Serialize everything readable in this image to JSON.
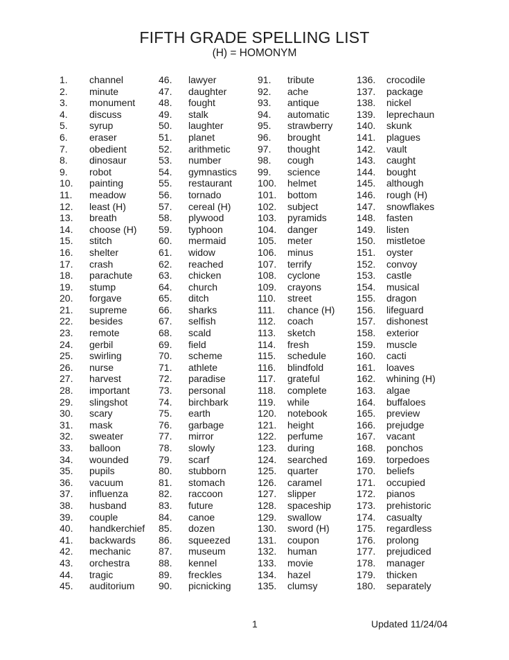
{
  "header": {
    "title": "FIFTH GRADE SPELLING LIST",
    "subtitle": "(H) = HOMONYM"
  },
  "columns": [
    [
      {
        "n": "1.",
        "w": "channel"
      },
      {
        "n": "2.",
        "w": "minute"
      },
      {
        "n": "3.",
        "w": "monument"
      },
      {
        "n": "4.",
        "w": "discuss"
      },
      {
        "n": "5.",
        "w": "syrup"
      },
      {
        "n": "6.",
        "w": "eraser"
      },
      {
        "n": "7.",
        "w": "obedient"
      },
      {
        "n": "8.",
        "w": "dinosaur"
      },
      {
        "n": "9.",
        "w": "robot"
      },
      {
        "n": "10.",
        "w": "painting"
      },
      {
        "n": "11.",
        "w": "meadow"
      },
      {
        "n": "12.",
        "w": "least (H)"
      },
      {
        "n": "13.",
        "w": "breath"
      },
      {
        "n": "14.",
        "w": "choose (H)"
      },
      {
        "n": "15.",
        "w": "stitch"
      },
      {
        "n": "16.",
        "w": "shelter"
      },
      {
        "n": "17.",
        "w": "crash"
      },
      {
        "n": "18.",
        "w": "parachute"
      },
      {
        "n": "19.",
        "w": "stump"
      },
      {
        "n": "20.",
        "w": "forgave"
      },
      {
        "n": "21.",
        "w": "supreme"
      },
      {
        "n": "22.",
        "w": "besides"
      },
      {
        "n": "23.",
        "w": "remote"
      },
      {
        "n": "24.",
        "w": "gerbil"
      },
      {
        "n": "25.",
        "w": "swirling"
      },
      {
        "n": "26.",
        "w": "nurse"
      },
      {
        "n": "27.",
        "w": "harvest"
      },
      {
        "n": "28.",
        "w": "important"
      },
      {
        "n": "29.",
        "w": "slingshot"
      },
      {
        "n": "30.",
        "w": "scary"
      },
      {
        "n": "31.",
        "w": "mask"
      },
      {
        "n": "32.",
        "w": "sweater"
      },
      {
        "n": "33.",
        "w": "balloon"
      },
      {
        "n": "34.",
        "w": "wounded"
      },
      {
        "n": "35.",
        "w": "pupils"
      },
      {
        "n": "36.",
        "w": "vacuum"
      },
      {
        "n": "37.",
        "w": "influenza"
      },
      {
        "n": "38.",
        "w": "husband"
      },
      {
        "n": "39.",
        "w": "couple"
      },
      {
        "n": "40.",
        "w": "handkerchief"
      },
      {
        "n": "41.",
        "w": "backwards"
      },
      {
        "n": "42.",
        "w": "mechanic"
      },
      {
        "n": "43.",
        "w": "orchestra"
      },
      {
        "n": "44.",
        "w": "tragic"
      },
      {
        "n": "45.",
        "w": "auditorium"
      }
    ],
    [
      {
        "n": "46.",
        "w": "lawyer"
      },
      {
        "n": "47.",
        "w": "daughter"
      },
      {
        "n": "48.",
        "w": "fought"
      },
      {
        "n": "49.",
        "w": "stalk"
      },
      {
        "n": "50.",
        "w": "laughter"
      },
      {
        "n": "51.",
        "w": "planet"
      },
      {
        "n": "52.",
        "w": "arithmetic"
      },
      {
        "n": "53.",
        "w": "number"
      },
      {
        "n": "54.",
        "w": "gymnastics"
      },
      {
        "n": "55.",
        "w": "restaurant"
      },
      {
        "n": "56.",
        "w": "tornado"
      },
      {
        "n": "57.",
        "w": "cereal (H)"
      },
      {
        "n": "58.",
        "w": "plywood"
      },
      {
        "n": "59.",
        "w": "typhoon"
      },
      {
        "n": "60.",
        "w": "mermaid"
      },
      {
        "n": "61.",
        "w": "widow"
      },
      {
        "n": "62.",
        "w": "reached"
      },
      {
        "n": "63.",
        "w": "chicken"
      },
      {
        "n": "64.",
        "w": "church"
      },
      {
        "n": "65.",
        "w": "ditch"
      },
      {
        "n": "66.",
        "w": "sharks"
      },
      {
        "n": "67.",
        "w": "selfish"
      },
      {
        "n": "68.",
        "w": "scald"
      },
      {
        "n": "69.",
        "w": "field"
      },
      {
        "n": "70.",
        "w": "scheme"
      },
      {
        "n": "71.",
        "w": "athlete"
      },
      {
        "n": "72.",
        "w": "paradise"
      },
      {
        "n": "73.",
        "w": "personal"
      },
      {
        "n": "74.",
        "w": "birchbark"
      },
      {
        "n": "75.",
        "w": "earth"
      },
      {
        "n": "76.",
        "w": "garbage"
      },
      {
        "n": "77.",
        "w": "mirror"
      },
      {
        "n": "78.",
        "w": "slowly"
      },
      {
        "n": "79.",
        "w": "scarf"
      },
      {
        "n": "80.",
        "w": "stubborn"
      },
      {
        "n": "81.",
        "w": "stomach"
      },
      {
        "n": "82.",
        "w": "raccoon"
      },
      {
        "n": "83.",
        "w": "future"
      },
      {
        "n": "84.",
        "w": "canoe"
      },
      {
        "n": "85.",
        "w": "dozen"
      },
      {
        "n": "86.",
        "w": "squeezed"
      },
      {
        "n": "87.",
        "w": "museum"
      },
      {
        "n": "88.",
        "w": "kennel"
      },
      {
        "n": "89.",
        "w": "freckles"
      },
      {
        "n": "90.",
        "w": "picnicking"
      }
    ],
    [
      {
        "n": "91.",
        "w": "tribute"
      },
      {
        "n": "92.",
        "w": "ache"
      },
      {
        "n": "93.",
        "w": "antique"
      },
      {
        "n": "94.",
        "w": "automatic"
      },
      {
        "n": "95.",
        "w": "strawberry"
      },
      {
        "n": "96.",
        "w": "brought"
      },
      {
        "n": "97.",
        "w": "thought"
      },
      {
        "n": "98.",
        "w": "cough"
      },
      {
        "n": "99.",
        "w": "science"
      },
      {
        "n": "100.",
        "w": "helmet"
      },
      {
        "n": "101.",
        "w": "bottom"
      },
      {
        "n": "102.",
        "w": "subject"
      },
      {
        "n": "103.",
        "w": "pyramids"
      },
      {
        "n": "104.",
        "w": "danger"
      },
      {
        "n": "105.",
        "w": "meter"
      },
      {
        "n": "106.",
        "w": "minus"
      },
      {
        "n": "107.",
        "w": "terrify"
      },
      {
        "n": "108.",
        "w": "cyclone"
      },
      {
        "n": "109.",
        "w": "crayons"
      },
      {
        "n": "110.",
        "w": "street"
      },
      {
        "n": "111.",
        "w": "chance (H)"
      },
      {
        "n": "112.",
        "w": "coach"
      },
      {
        "n": "113.",
        "w": "sketch"
      },
      {
        "n": "114.",
        "w": "fresh"
      },
      {
        "n": "115.",
        "w": "schedule"
      },
      {
        "n": "116.",
        "w": "blindfold"
      },
      {
        "n": "117.",
        "w": "grateful"
      },
      {
        "n": "118.",
        "w": "complete"
      },
      {
        "n": "119.",
        "w": "while"
      },
      {
        "n": "120.",
        "w": "notebook"
      },
      {
        "n": "121.",
        "w": "height"
      },
      {
        "n": "122.",
        "w": "perfume"
      },
      {
        "n": "123.",
        "w": "during"
      },
      {
        "n": "124.",
        "w": "searched"
      },
      {
        "n": "125.",
        "w": "quarter"
      },
      {
        "n": "126.",
        "w": "caramel"
      },
      {
        "n": "127.",
        "w": "slipper"
      },
      {
        "n": "128.",
        "w": "spaceship"
      },
      {
        "n": "129.",
        "w": "swallow"
      },
      {
        "n": "130.",
        "w": "sword (H)"
      },
      {
        "n": "131.",
        "w": "coupon"
      },
      {
        "n": "132.",
        "w": "human"
      },
      {
        "n": "133.",
        "w": "movie"
      },
      {
        "n": "134.",
        "w": "hazel"
      },
      {
        "n": "135.",
        "w": "clumsy"
      }
    ],
    [
      {
        "n": "136.",
        "w": "crocodile"
      },
      {
        "n": "137.",
        "w": "package"
      },
      {
        "n": "138.",
        "w": "nickel"
      },
      {
        "n": "139.",
        "w": "leprechaun"
      },
      {
        "n": "140.",
        "w": "skunk"
      },
      {
        "n": "141.",
        "w": "plagues"
      },
      {
        "n": "142.",
        "w": "vault"
      },
      {
        "n": "143.",
        "w": "caught"
      },
      {
        "n": "144.",
        "w": "bought"
      },
      {
        "n": "145.",
        "w": "although"
      },
      {
        "n": "146.",
        "w": "rough (H)"
      },
      {
        "n": "147.",
        "w": "snowflakes"
      },
      {
        "n": "148.",
        "w": "fasten"
      },
      {
        "n": "149.",
        "w": "listen"
      },
      {
        "n": "150.",
        "w": "mistletoe"
      },
      {
        "n": "151.",
        "w": "oyster"
      },
      {
        "n": "152.",
        "w": "convoy"
      },
      {
        "n": "153.",
        "w": "castle"
      },
      {
        "n": "154.",
        "w": "musical"
      },
      {
        "n": "155.",
        "w": "dragon"
      },
      {
        "n": "156.",
        "w": "lifeguard"
      },
      {
        "n": "157.",
        "w": "dishonest"
      },
      {
        "n": "158.",
        "w": "exterior"
      },
      {
        "n": "159.",
        "w": "muscle"
      },
      {
        "n": "160.",
        "w": "cacti"
      },
      {
        "n": "161.",
        "w": "loaves"
      },
      {
        "n": "162.",
        "w": "whining (H)"
      },
      {
        "n": "163.",
        "w": "algae"
      },
      {
        "n": "164.",
        "w": "buffaloes"
      },
      {
        "n": "165.",
        "w": "preview"
      },
      {
        "n": "166.",
        "w": "prejudge"
      },
      {
        "n": "167.",
        "w": "vacant"
      },
      {
        "n": "168.",
        "w": "ponchos"
      },
      {
        "n": "169.",
        "w": "torpedoes"
      },
      {
        "n": "170.",
        "w": "beliefs"
      },
      {
        "n": "171.",
        "w": "occupied"
      },
      {
        "n": "172.",
        "w": "pianos"
      },
      {
        "n": "173.",
        "w": "prehistoric"
      },
      {
        "n": "174.",
        "w": "casualty"
      },
      {
        "n": "175.",
        "w": "regardless"
      },
      {
        "n": "176.",
        "w": "prolong"
      },
      {
        "n": "177.",
        "w": "prejudiced"
      },
      {
        "n": "178.",
        "w": "manager"
      },
      {
        "n": "179.",
        "w": "thicken"
      },
      {
        "n": "180.",
        "w": "separately"
      }
    ]
  ],
  "footer": {
    "page_number": "1",
    "updated": "Updated 11/24/04"
  }
}
